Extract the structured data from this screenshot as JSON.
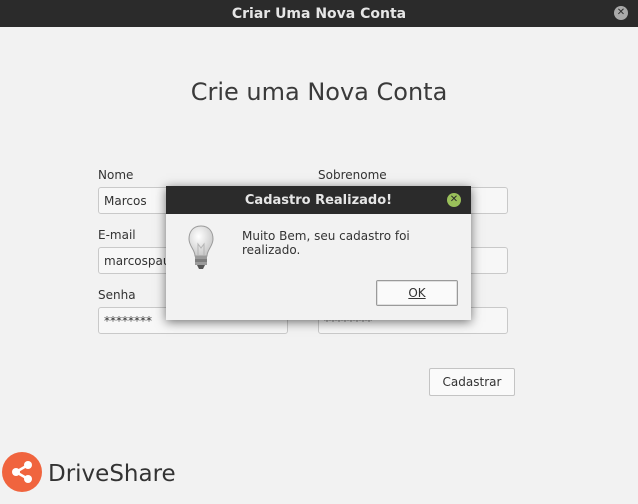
{
  "window": {
    "title": "Criar Uma Nova Conta",
    "close_icon": "close-icon"
  },
  "page": {
    "heading": "Crie uma Nova Conta"
  },
  "form": {
    "nome": {
      "label": "Nome",
      "value": "Marcos"
    },
    "sobrenome": {
      "label": "Sobrenome",
      "value": ""
    },
    "email": {
      "label": "E-mail",
      "value": "marcospau"
    },
    "senha": {
      "label": "Senha",
      "value": "********"
    },
    "confirm_senha": {
      "value": "********"
    },
    "submit_label": "Cadastrar"
  },
  "brand": {
    "name": "DriveShare",
    "accent": "#f0643e",
    "icon": "share-icon"
  },
  "dialog": {
    "title": "Cadastro Realizado!",
    "message": "Muito Bem, seu cadastro foi realizado.",
    "ok_label": "OK",
    "icon": "lightbulb-icon",
    "close_color": "#9ac05a"
  },
  "colors": {
    "titlebar": "#2b2b2b",
    "background": "#f2f2f2"
  }
}
